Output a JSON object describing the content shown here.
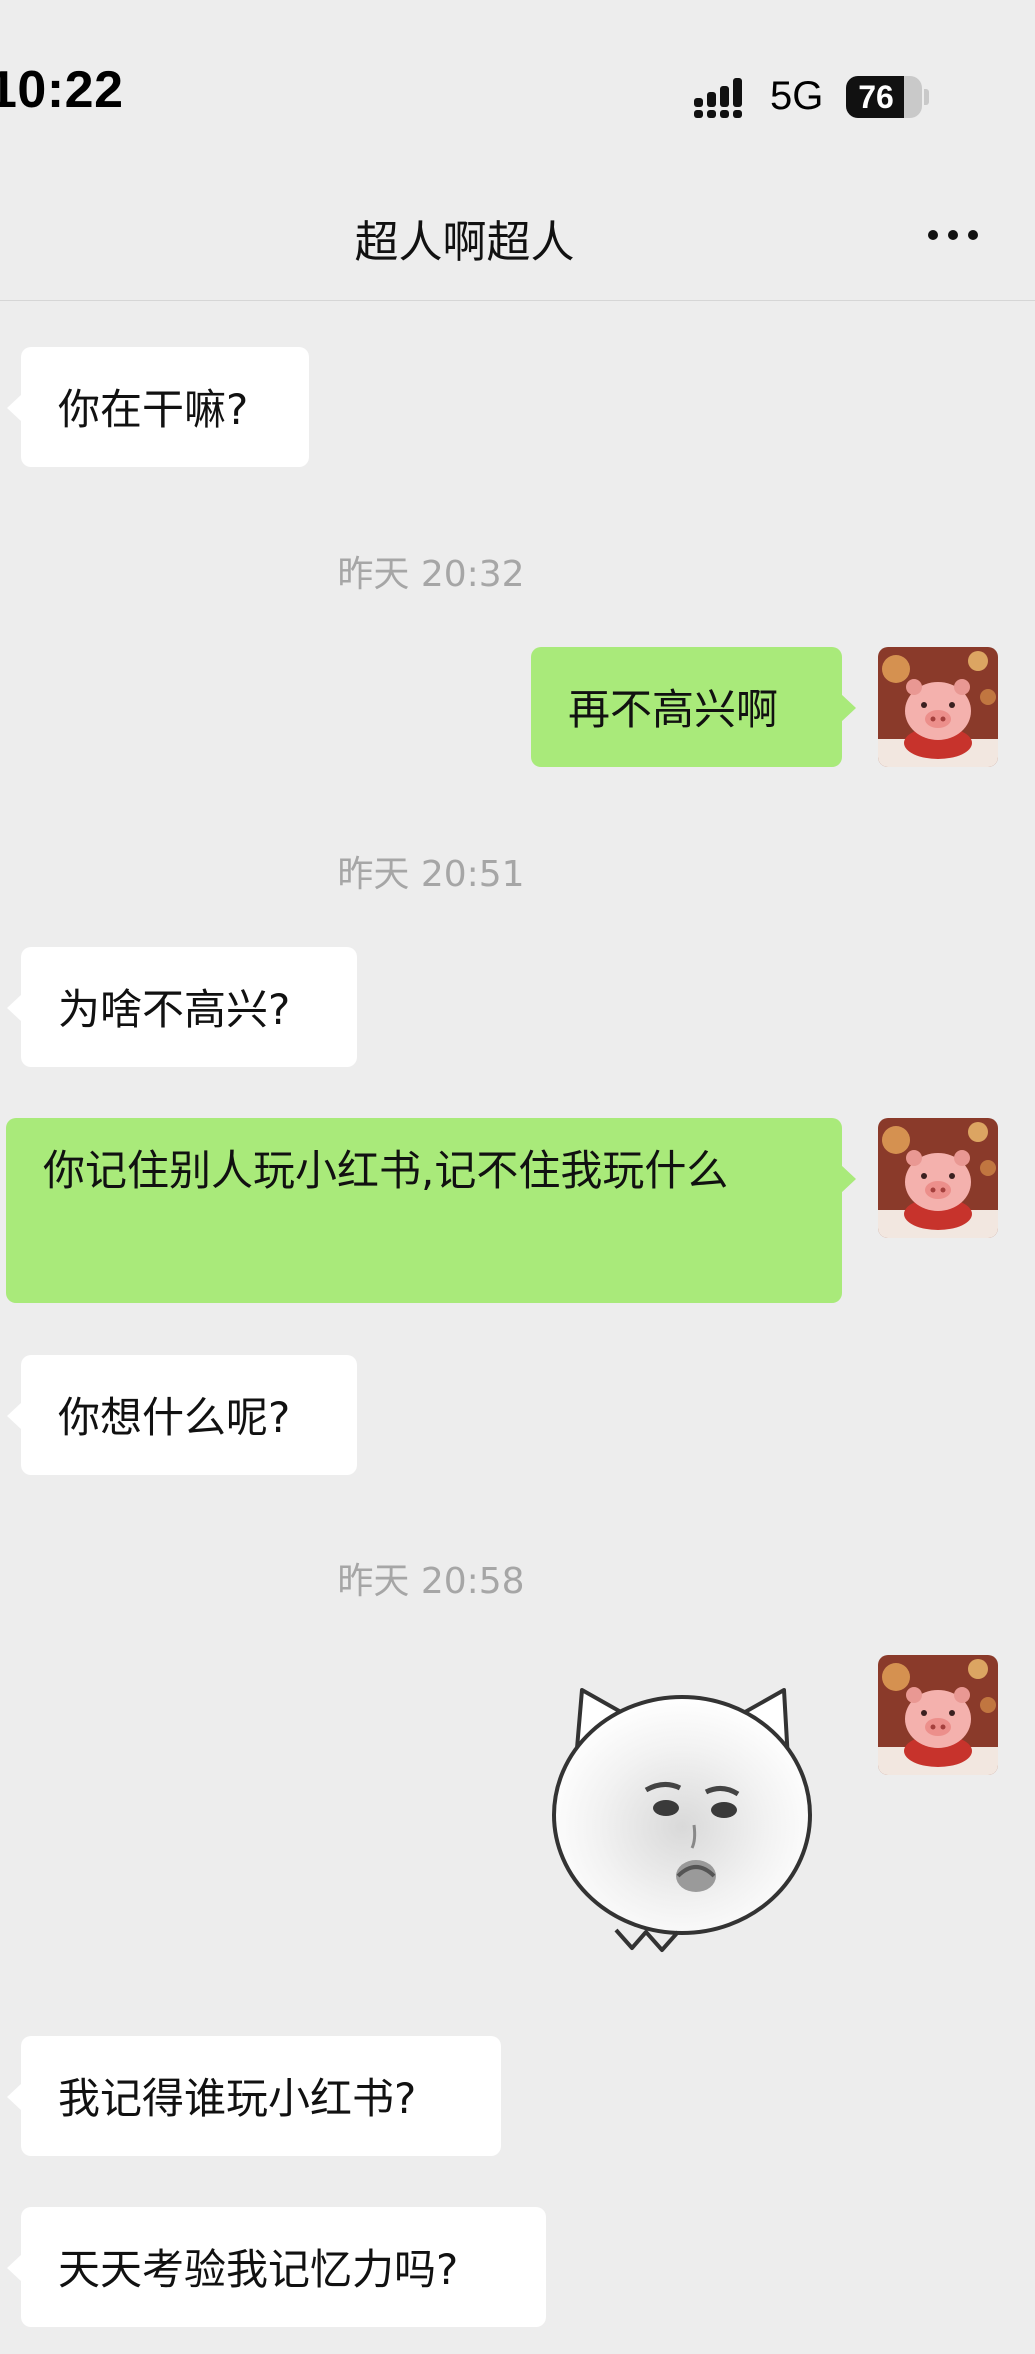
{
  "status_bar": {
    "time": "10:22",
    "network": "5G",
    "battery_level": "76",
    "battery_fraction": 0.76
  },
  "header": {
    "title": "超人啊超人",
    "more_icon": "more-dots-icon"
  },
  "messages": [
    {
      "type": "text",
      "side": "left",
      "text": "你在干嘛?"
    },
    {
      "type": "timestamp",
      "text": "昨天 20:32"
    },
    {
      "type": "text",
      "side": "right",
      "text": "再不高兴啊"
    },
    {
      "type": "timestamp",
      "text": "昨天 20:51"
    },
    {
      "type": "text",
      "side": "left",
      "text": "为啥不高兴?"
    },
    {
      "type": "text",
      "side": "right",
      "text": "你记住别人玩小红书,记不住我玩什么"
    },
    {
      "type": "text",
      "side": "left",
      "text": "你想什么呢?"
    },
    {
      "type": "timestamp",
      "text": "昨天 20:58"
    },
    {
      "type": "sticker",
      "side": "right",
      "sticker": "pouting-cat-face-sticker"
    },
    {
      "type": "text",
      "side": "left",
      "text": "我记得谁玩小红书?"
    },
    {
      "type": "text",
      "side": "left",
      "text": "天天考验我记忆力吗?"
    }
  ],
  "colors": {
    "background": "#ededed",
    "outgoing_bubble": "#a9ea7a",
    "incoming_bubble": "#ffffff",
    "timestamp_text": "#a6a6a6"
  }
}
